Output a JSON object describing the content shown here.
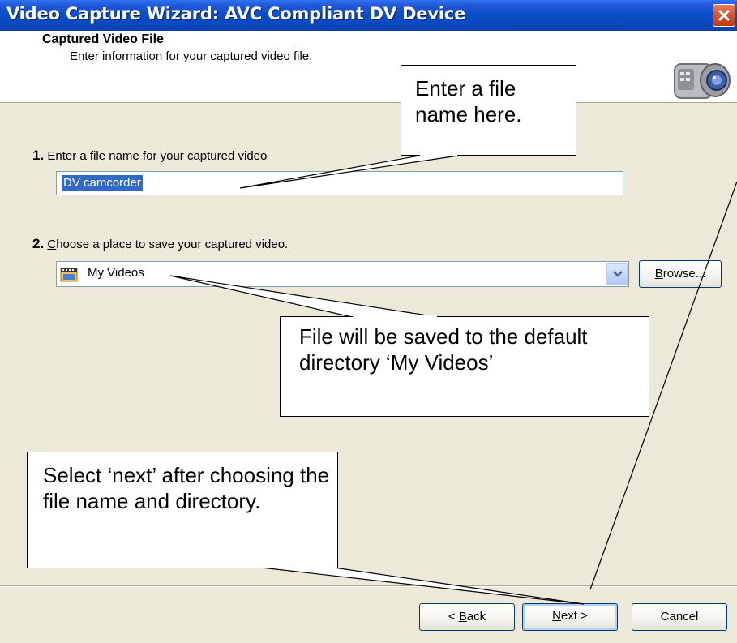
{
  "window": {
    "title": "Video Capture Wizard: AVC Compliant DV Device"
  },
  "header": {
    "title": "Captured Video File",
    "subtitle": "Enter information for your captured video file.",
    "icon": "camcorder-icon"
  },
  "step1": {
    "number": "1.",
    "label_prefix": "En",
    "label_accel": "t",
    "label_suffix": "er a file name for your captured video",
    "value": "DV camcorder"
  },
  "step2": {
    "number": "2.",
    "label_accel": "C",
    "label_suffix": "hoose a place to save your captured video.",
    "folder": "My Videos",
    "folder_icon": "folder-icon",
    "browse_accel": "B",
    "browse_suffix": "rowse..."
  },
  "buttons": {
    "back_prefix": "< ",
    "back_accel": "B",
    "back_suffix": "ack",
    "next_accel": "N",
    "next_suffix": "ext >",
    "cancel": "Cancel"
  },
  "callouts": {
    "filename": "Enter a file name here.",
    "directory": "File will be saved to the default directory ‘My Videos’",
    "next": "Select ‘next’ after choosing the file name and directory."
  },
  "colors": {
    "titlebar": "#0a4ec9",
    "close": "#d9522b",
    "dialog_bg": "#ece9d8",
    "selection": "#316ac5"
  }
}
